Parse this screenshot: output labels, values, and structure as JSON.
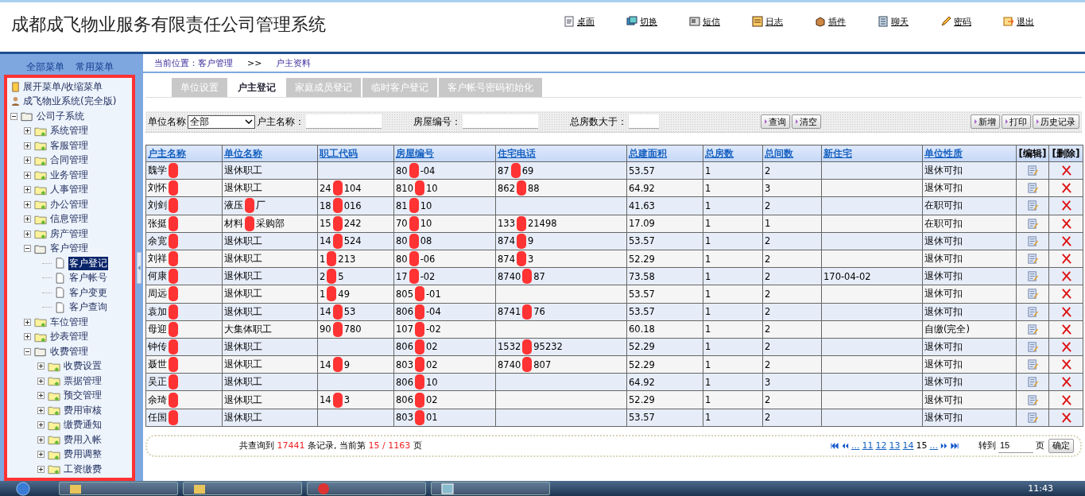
{
  "header": {
    "title": "成都成飞物业服务有限责任公司管理系统",
    "nav": [
      "桌面",
      "切换",
      "短信",
      "日志",
      "插件",
      "聊天",
      "密码",
      "退出"
    ]
  },
  "sidebar": {
    "tabs": [
      "全部菜单",
      "常用菜单"
    ],
    "tree": [
      {
        "label": "展开菜单/收缩菜单",
        "kind": "toggle"
      },
      {
        "label": "成飞物业系统(完全版)",
        "kind": "system"
      },
      {
        "label": "公司子系统",
        "kind": "folder",
        "expanded": true,
        "children": [
          {
            "label": "系统管理",
            "kind": "folder",
            "expanded": false
          },
          {
            "label": "客服管理",
            "kind": "folder",
            "expanded": false
          },
          {
            "label": "合同管理",
            "kind": "folder",
            "expanded": false
          },
          {
            "label": "业务管理",
            "kind": "folder",
            "expanded": false
          },
          {
            "label": "人事管理",
            "kind": "folder",
            "expanded": false
          },
          {
            "label": "办公管理",
            "kind": "folder",
            "expanded": false
          },
          {
            "label": "信息管理",
            "kind": "folder",
            "expanded": false
          },
          {
            "label": "房产管理",
            "kind": "folder",
            "expanded": false
          },
          {
            "label": "客户管理",
            "kind": "folder",
            "expanded": true,
            "children": [
              {
                "label": "客户登记",
                "kind": "page",
                "selected": true
              },
              {
                "label": "客户帐号",
                "kind": "page",
                "selected": false
              },
              {
                "label": "客户变更",
                "kind": "page",
                "selected": false
              },
              {
                "label": "客户查询",
                "kind": "page",
                "selected": false
              }
            ]
          },
          {
            "label": "车位管理",
            "kind": "folder",
            "expanded": false
          },
          {
            "label": "抄表管理",
            "kind": "folder",
            "expanded": false
          },
          {
            "label": "收费管理",
            "kind": "folder",
            "expanded": true,
            "children": [
              {
                "label": "收费设置",
                "kind": "folder",
                "expanded": false
              },
              {
                "label": "票据管理",
                "kind": "folder",
                "expanded": false
              },
              {
                "label": "预交管理",
                "kind": "folder",
                "expanded": false
              },
              {
                "label": "费用审核",
                "kind": "folder",
                "expanded": false
              },
              {
                "label": "缴费通知",
                "kind": "folder",
                "expanded": false
              },
              {
                "label": "费用入帐",
                "kind": "folder",
                "expanded": false
              },
              {
                "label": "费用调整",
                "kind": "folder",
                "expanded": false
              },
              {
                "label": "工资缴费",
                "kind": "folder",
                "expanded": false
              }
            ]
          }
        ]
      }
    ]
  },
  "breadcrumb": {
    "location": "当前位置：客户管理",
    "separator": ">>",
    "page": "户主资料"
  },
  "tabs": [
    {
      "label": "单位设置",
      "selected": false
    },
    {
      "label": "户主登记",
      "selected": true
    },
    {
      "label": "家庭成员登记",
      "selected": false
    },
    {
      "label": "临时客户登记",
      "selected": false
    },
    {
      "label": "客户帐号密码初始化",
      "selected": false
    }
  ],
  "filters": {
    "unit_label": "单位名称",
    "unit_value": "全部",
    "owner_label": "户主名称：",
    "house_label": "房屋编号：",
    "rooms_label": "总房数大于：",
    "search_buttons": [
      "查询",
      "清空"
    ],
    "action_buttons": [
      "新增",
      "打印",
      "历史记录"
    ]
  },
  "table": {
    "columns": [
      {
        "label": "户主名称",
        "kind": "link"
      },
      {
        "label": "单位名称",
        "kind": "link"
      },
      {
        "label": "职工代码",
        "kind": "link"
      },
      {
        "label": "房屋编号",
        "kind": "link"
      },
      {
        "label": "住宅电话",
        "kind": "link"
      },
      {
        "label": "总建面积",
        "kind": "link"
      },
      {
        "label": "总房数",
        "kind": "link"
      },
      {
        "label": "总间数",
        "kind": "link"
      },
      {
        "label": "新住宅",
        "kind": "link"
      },
      {
        "label": "单位性质",
        "kind": "link"
      },
      {
        "label": "[编辑]",
        "kind": "edit"
      },
      {
        "label": "[删除]",
        "kind": "delete"
      }
    ],
    "rows": [
      {
        "cells": [
          [
            "魏学"
          ],
          "退休职工",
          null,
          [
            "80",
            "-04"
          ],
          [
            "87",
            "69"
          ],
          "53.57",
          "1",
          "2",
          null,
          "退休可扣"
        ]
      },
      {
        "cells": [
          [
            "刘怀"
          ],
          "退休职工",
          [
            "24",
            "104"
          ],
          [
            "810",
            "10"
          ],
          [
            "862",
            "88"
          ],
          "64.92",
          "1",
          "3",
          null,
          "退休可扣"
        ]
      },
      {
        "cells": [
          [
            "刘剑"
          ],
          [
            "液压",
            "厂"
          ],
          [
            "18",
            "016"
          ],
          [
            "81",
            "10"
          ],
          null,
          "41.63",
          "1",
          "2",
          null,
          "在职可扣"
        ]
      },
      {
        "cells": [
          [
            "张挺"
          ],
          [
            "材料",
            "采购部"
          ],
          [
            "15",
            "242"
          ],
          [
            "70",
            "10"
          ],
          [
            "133",
            "21498"
          ],
          "17.09",
          "1",
          "1",
          null,
          "在职可扣"
        ]
      },
      {
        "cells": [
          [
            "余宽"
          ],
          "退休职工",
          [
            "14",
            "524"
          ],
          [
            "80",
            "08"
          ],
          [
            "874",
            "9"
          ],
          "53.57",
          "1",
          "2",
          null,
          "退休可扣"
        ]
      },
      {
        "cells": [
          [
            "刘祥"
          ],
          "退休职工",
          [
            "1",
            "213"
          ],
          [
            "80",
            "-06"
          ],
          [
            "874",
            "3"
          ],
          "52.29",
          "1",
          "2",
          null,
          "退休可扣"
        ]
      },
      {
        "cells": [
          [
            "何康"
          ],
          "退休职工",
          [
            "2",
            "5"
          ],
          [
            "17",
            "-02"
          ],
          [
            "8740",
            "87"
          ],
          "73.58",
          "1",
          "2",
          "170-04-02",
          "退休可扣"
        ]
      },
      {
        "cells": [
          [
            "周远"
          ],
          "退休职工",
          [
            "1",
            "49"
          ],
          [
            "805",
            "-01"
          ],
          null,
          "53.57",
          "1",
          "2",
          null,
          "退休可扣"
        ]
      },
      {
        "cells": [
          [
            "袁加"
          ],
          "退休职工",
          [
            "14",
            "53"
          ],
          [
            "806",
            "-04"
          ],
          [
            "8741",
            "76"
          ],
          "53.57",
          "1",
          "2",
          null,
          "退休可扣"
        ]
      },
      {
        "cells": [
          [
            "母迎"
          ],
          "大集体职工",
          [
            "90",
            "780"
          ],
          [
            "107",
            "-02"
          ],
          null,
          "60.18",
          "1",
          "2",
          null,
          "自缴(完全)"
        ]
      },
      {
        "cells": [
          [
            "钟传"
          ],
          "退休职工",
          null,
          [
            "806",
            "02"
          ],
          [
            "1532",
            "95232"
          ],
          "52.29",
          "1",
          "2",
          null,
          "退休可扣"
        ]
      },
      {
        "cells": [
          [
            "聂世"
          ],
          "退休职工",
          [
            "14",
            "9"
          ],
          [
            "803",
            "02"
          ],
          [
            "8740",
            "807"
          ],
          "52.29",
          "1",
          "2",
          null,
          "退休可扣"
        ]
      },
      {
        "cells": [
          [
            "吴正"
          ],
          "退休职工",
          null,
          [
            "806",
            "10"
          ],
          null,
          "64.92",
          "1",
          "3",
          null,
          "退休可扣"
        ]
      },
      {
        "cells": [
          [
            "余琦"
          ],
          "退休职工",
          [
            "14",
            "3"
          ],
          [
            "806",
            "02"
          ],
          null,
          "52.29",
          "1",
          "2",
          null,
          "退休可扣"
        ]
      },
      {
        "cells": [
          [
            "任国"
          ],
          "退休职工",
          null,
          [
            "803",
            "01"
          ],
          null,
          "53.57",
          "1",
          "2",
          null,
          "退休可扣"
        ]
      }
    ]
  },
  "footer": {
    "summary": [
      "共查询到 ",
      "17441",
      " 条记录, 当前第 ",
      "15 / 1163",
      " 页"
    ],
    "pages": [
      {
        "label": "...",
        "selected": false
      },
      {
        "label": "11",
        "selected": false
      },
      {
        "label": "12",
        "selected": false
      },
      {
        "label": "13",
        "selected": false
      },
      {
        "label": "14",
        "selected": false
      },
      {
        "label": "15",
        "selected": true
      },
      {
        "label": "...",
        "selected": false
      }
    ],
    "goto_label": "转到",
    "goto_value": "15",
    "page_unit": "页",
    "confirm": "确定"
  },
  "taskbar": {
    "clock": "11:43"
  }
}
